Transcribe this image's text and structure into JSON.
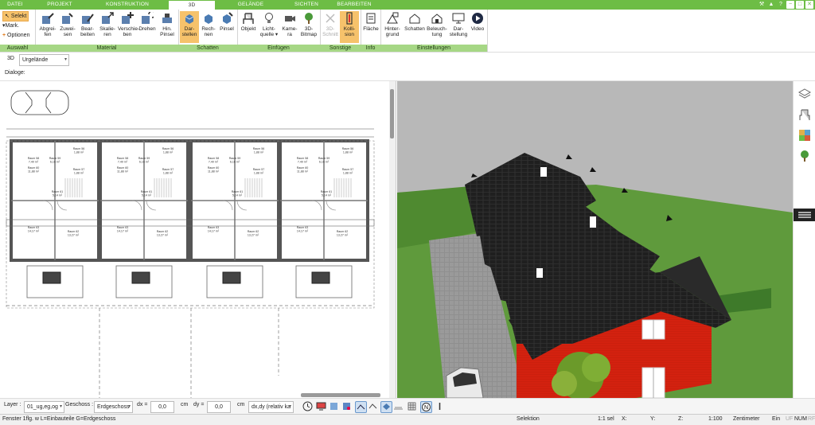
{
  "tabs": [
    {
      "label": "DATEI"
    },
    {
      "label": "PROJEKT"
    },
    {
      "label": "KONSTRUKTION"
    },
    {
      "label": "3D"
    },
    {
      "label": "GELÄNDE"
    },
    {
      "label": "SICHTEN"
    },
    {
      "label": "BEARBEITEN"
    }
  ],
  "window_controls": [
    "▲",
    "−",
    "□",
    "✕"
  ],
  "ribbon": {
    "auswahl": {
      "label": "Auswahl",
      "select": "Selekt",
      "mark": "Mark.",
      "options": "Optionen"
    },
    "material": {
      "label": "Material",
      "buttons": [
        "Abgrei-\nfen",
        "Zuwei-\nsen",
        "Bear-\nbeiten",
        "Skalie-\nren",
        "Verschie-\nben",
        "Drehen",
        "Hin.\nPinsel"
      ]
    },
    "schatten": {
      "label": "Schatten",
      "buttons": [
        "Dar-\nstellen",
        "Rech-\nnen",
        "Pinsel"
      ]
    },
    "einfuegen": {
      "label": "Einfügen",
      "buttons": [
        "Objekt",
        "Licht-\nquelle ▾",
        "Kame-\nra",
        "3D-\nBitmap"
      ]
    },
    "sonstige": {
      "label": "Sonstige",
      "buttons": [
        "3D-\nSchnitt",
        "Kolli-\nsion"
      ]
    },
    "info": {
      "label": "Info",
      "buttons": [
        "Fläche"
      ]
    },
    "einstellungen": {
      "label": "Einstellungen",
      "buttons": [
        "Hinter-\ngrund",
        "Schatten",
        "Beleuch-\ntung",
        "Dar-\nstellung",
        "Video"
      ]
    }
  },
  "viewbar": {
    "mode": "3D",
    "terrain": "Urgelände"
  },
  "dialoge_label": "Dialoge:",
  "plan": {
    "rooms": [
      {
        "name": "Raum 56",
        "area": "1,88 m²"
      },
      {
        "name": "Raum 59",
        "area": "6,16 m²"
      },
      {
        "name": "Raum 58",
        "area": "7,40 m²"
      },
      {
        "name": "Raum 60",
        "area": "11,88 m²"
      },
      {
        "name": "Raum 61",
        "area": "5,14 m²"
      },
      {
        "name": "Raum 63",
        "area": "14,17 m²"
      },
      {
        "name": "Raum 62",
        "area": "13,27 m²"
      },
      {
        "name": "Raum 57",
        "area": "1,88 m²"
      }
    ]
  },
  "bottombar": {
    "layer_label": "Layer :",
    "layer_value": "01_ug,eg,og",
    "geschoss_label": "Geschoss :",
    "geschoss_value": "Erdgeschoss",
    "dx_label": "dx =",
    "dx_value": "0,0",
    "dx_unit": "cm",
    "dy_label": "dy =",
    "dy_value": "0,0",
    "dy_unit": "cm",
    "mode_value": "dx,dy (relativ ka"
  },
  "status": {
    "hint": "Fenster 1flg. w L=Einbauteile G=Erdgeschoss",
    "mode": "Selektion",
    "scale_sel": "1:1 sel",
    "x": "X:",
    "y": "Y:",
    "z": "Z:",
    "scale": "1:100",
    "unit": "Zentimeter",
    "ein": "Ein",
    "uf": "UF",
    "num": "NUM",
    "rf": "RF"
  },
  "colors": {
    "accent_green": "#6dbd45",
    "group_label_green": "#a6d785",
    "active_orange": "#f6c26b",
    "brick_red": "#d3210f",
    "roof_black": "#1f1f1f",
    "lawn_green": "#5f9a3c"
  }
}
